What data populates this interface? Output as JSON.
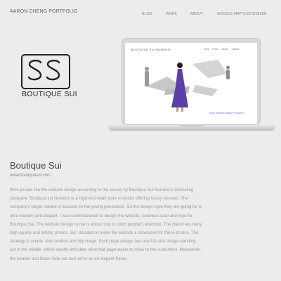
{
  "header": {
    "site_title": "AARON CHENG PORTFOLIO",
    "nav": [
      "BLOG",
      "WORK",
      "ABOUT",
      "GOOGLE MAP CUSTOMIZER"
    ]
  },
  "logo": {
    "text": "BOUTIQUE SUI",
    "mark": "SS"
  },
  "preview": {
    "brand": "BOUTIQUE SUI NUMERIS",
    "nav": [
      "Work",
      "Photo",
      "Studio",
      "Contact"
    ],
    "caption": "Party Dresses Holiday Promotion"
  },
  "project": {
    "title": "Boutique Sui",
    "url": "www.boutiquesui.com",
    "description": "96% people like the website design according to the survey by Boutique Sui Numeris's marketing company. Boutique sui Numeris is a high-end retail store in Austin offering luxury dresses. The company's target market is focused on the young generation. So the design style they are going for is ultra modern and elegant. I was commissioned to design the website, business card and logo for Boutique Sui. The website design to me is about how to catch people's attention. The client has many high-quality and artistic photos. So I decided to make the website a showcase for those photos. The strategy is simple: less content and big image. Each page always has one full-size image standing out in the middle, which clearly articulate what that page wants to show to the customers. Meanwhile, the header and footer fade out and serve as an elegant frame."
  },
  "colors": {
    "background": "#ececec",
    "dress": "#5b3fa6",
    "text": "#777777"
  }
}
